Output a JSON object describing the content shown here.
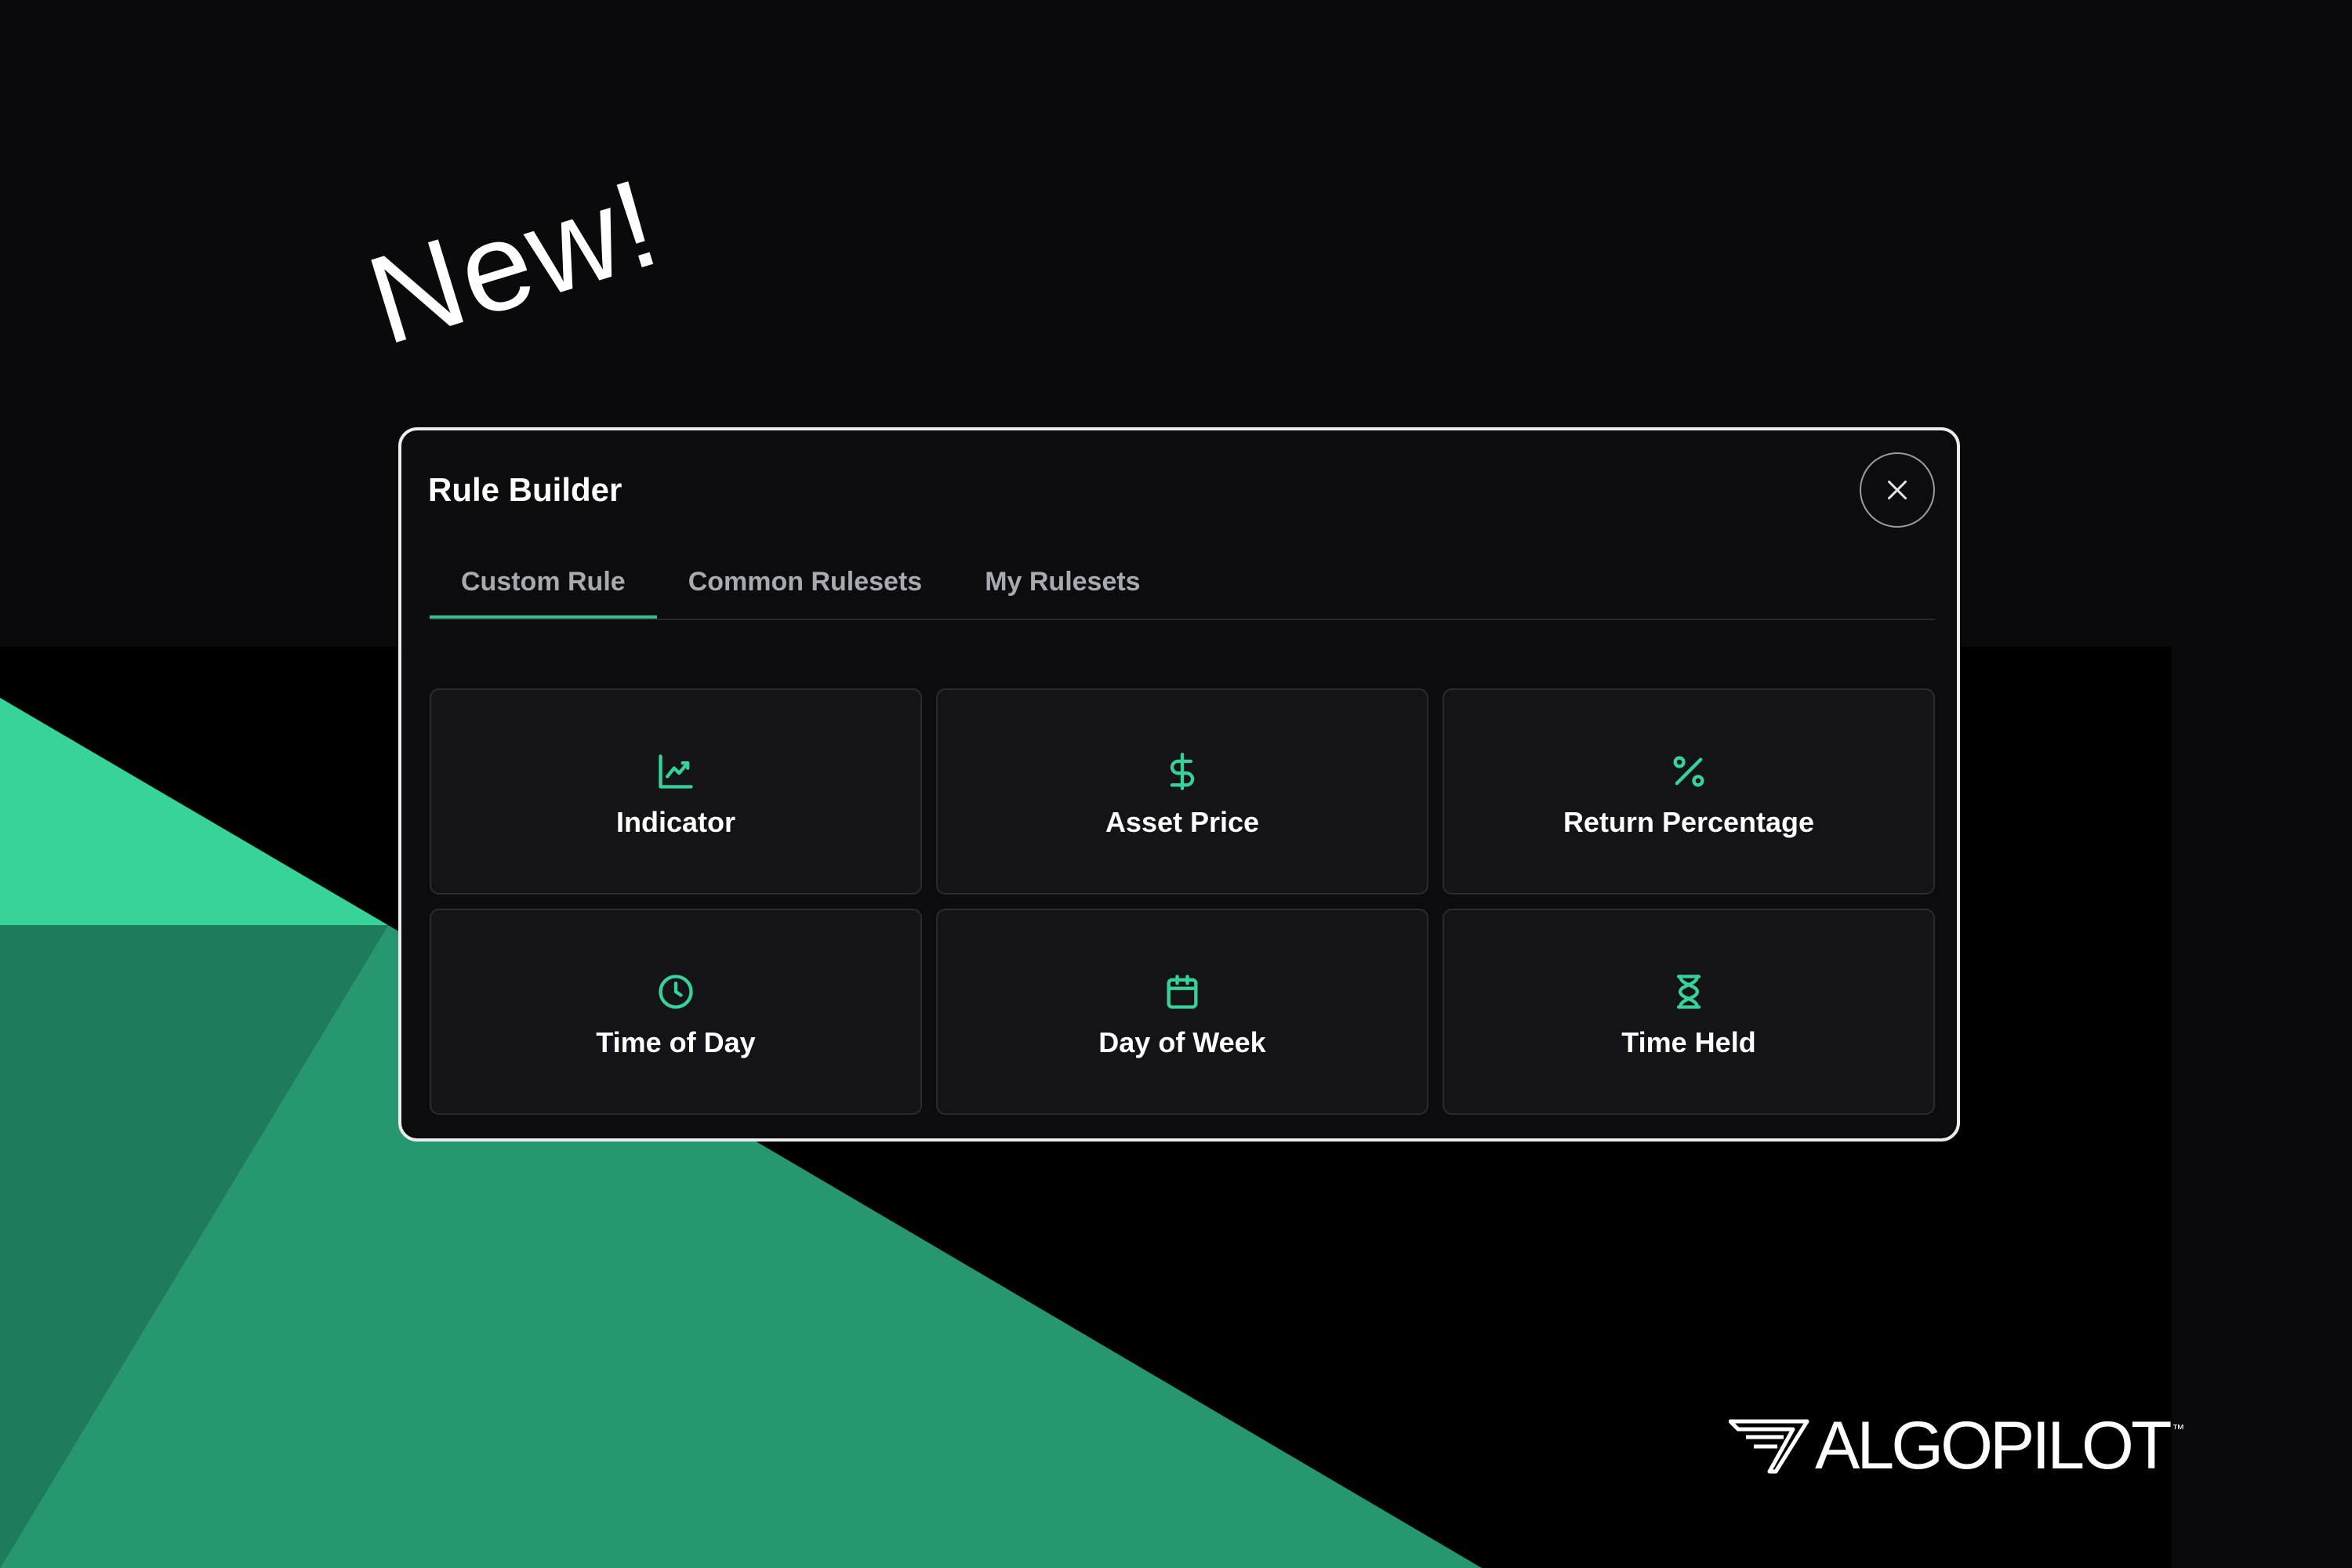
{
  "promo": {
    "new_label": "New!"
  },
  "modal": {
    "title": "Rule Builder",
    "close_icon": "close-icon",
    "tabs": [
      {
        "label": "Custom Rule",
        "active": true
      },
      {
        "label": "Common Rulesets",
        "active": false
      },
      {
        "label": "My Rulesets",
        "active": false
      }
    ],
    "options": [
      {
        "label": "Indicator",
        "icon": "chart-line-icon"
      },
      {
        "label": "Asset Price",
        "icon": "dollar-icon"
      },
      {
        "label": "Return Percentage",
        "icon": "percent-icon"
      },
      {
        "label": "Time of Day",
        "icon": "clock-icon"
      },
      {
        "label": "Day of Week",
        "icon": "calendar-icon"
      },
      {
        "label": "Time Held",
        "icon": "hourglass-icon"
      }
    ]
  },
  "brand": {
    "name": "ALGOPILOT",
    "trademark": "™"
  },
  "colors": {
    "accent": "#36d399",
    "background": "#0a0a0c",
    "card": "#141418",
    "green_light": "#37d399",
    "green_mid": "#279770",
    "green_dark": "#1e7b5c"
  }
}
